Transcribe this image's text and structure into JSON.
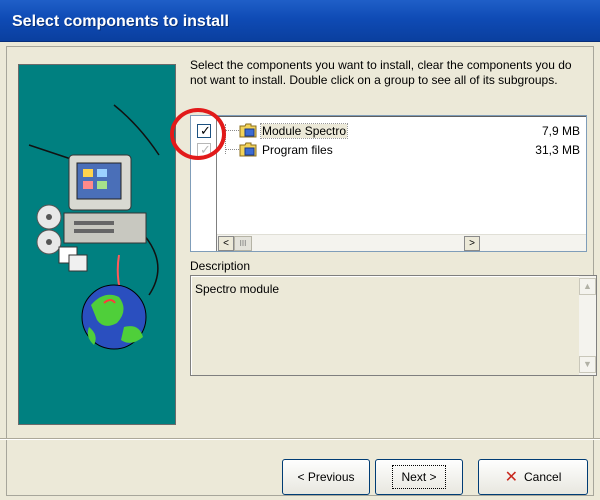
{
  "window": {
    "title": "Select components to install"
  },
  "instructions": "Select the components you want to install, clear the components you do not want to install. Double click on a group to see all of its subgroups.",
  "components": [
    {
      "label": "Module Spectro",
      "size": "7,9 MB",
      "checked": true,
      "enabled": true,
      "icon": "folder-icon"
    },
    {
      "label": "Program files",
      "size": "31,3 MB",
      "checked": true,
      "enabled": false,
      "icon": "folder-icon"
    }
  ],
  "scrollbar": {
    "left_arrow": "<",
    "right_arrow": ">",
    "thumb": "III"
  },
  "description": {
    "label": "Description",
    "text": "Spectro module"
  },
  "buttons": {
    "previous": "< Previous",
    "next": "Next >",
    "cancel": "Cancel"
  },
  "colors": {
    "title_bar": "#0f4bb5",
    "art_background": "#008080",
    "highlight_circle": "#e21a1a",
    "cancel_icon": "#c8281e"
  }
}
